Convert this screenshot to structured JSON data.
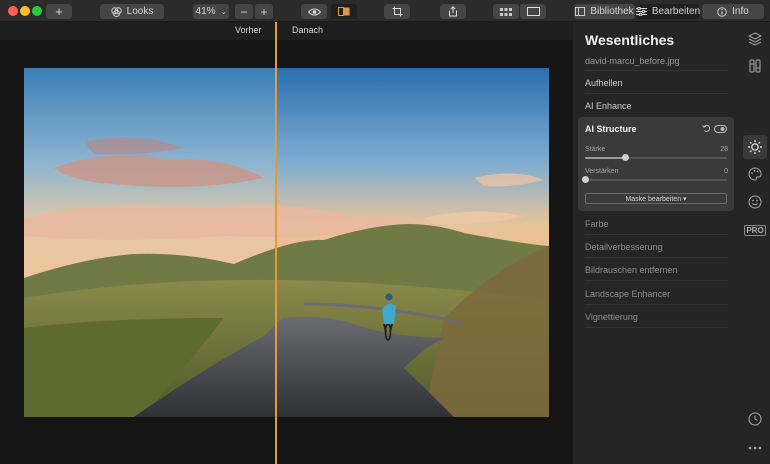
{
  "toolbar": {
    "add_label": "+",
    "looks_label": "Looks",
    "zoom_value": "41%",
    "zoom_minus_label": "−",
    "zoom_plus_label": "+",
    "library_label": "Bibliothek",
    "edit_label": "Bearbeiten",
    "info_label": "Info"
  },
  "canvas": {
    "before_label": "Vorher",
    "after_label": "Danach",
    "comparison_split": 0.48
  },
  "sidebar": {
    "title": "Wesentliches",
    "file_name": "david-marcu_before.jpg",
    "items_top": [
      "Aufhellen",
      "AI Enhance"
    ],
    "card": {
      "title": "AI Structure",
      "sliders": [
        {
          "label": "Stärke",
          "value": "28",
          "level": 0.28
        },
        {
          "label": "Verstärken",
          "value": "0",
          "level": 0
        }
      ],
      "mask_button": "Maske bearbeiten ▾"
    },
    "items_bottom": [
      "Farbe",
      "Detailverbesserung",
      "Bildrauschen entfernen",
      "Landscape Enhancer",
      "Vignettierung"
    ]
  },
  "rail": {
    "pro_label": "PRO",
    "icons": [
      "layers-icon",
      "adjust-icon",
      "sun-icon",
      "palette-icon",
      "face-icon",
      "pro-icon",
      "history-icon",
      "more-icon"
    ]
  },
  "colors": {
    "divider": "#e59a3a",
    "toolbar_bg": "#2b2b2b",
    "sidebar_bg": "#252525",
    "card_bg": "#3a3a3a"
  }
}
